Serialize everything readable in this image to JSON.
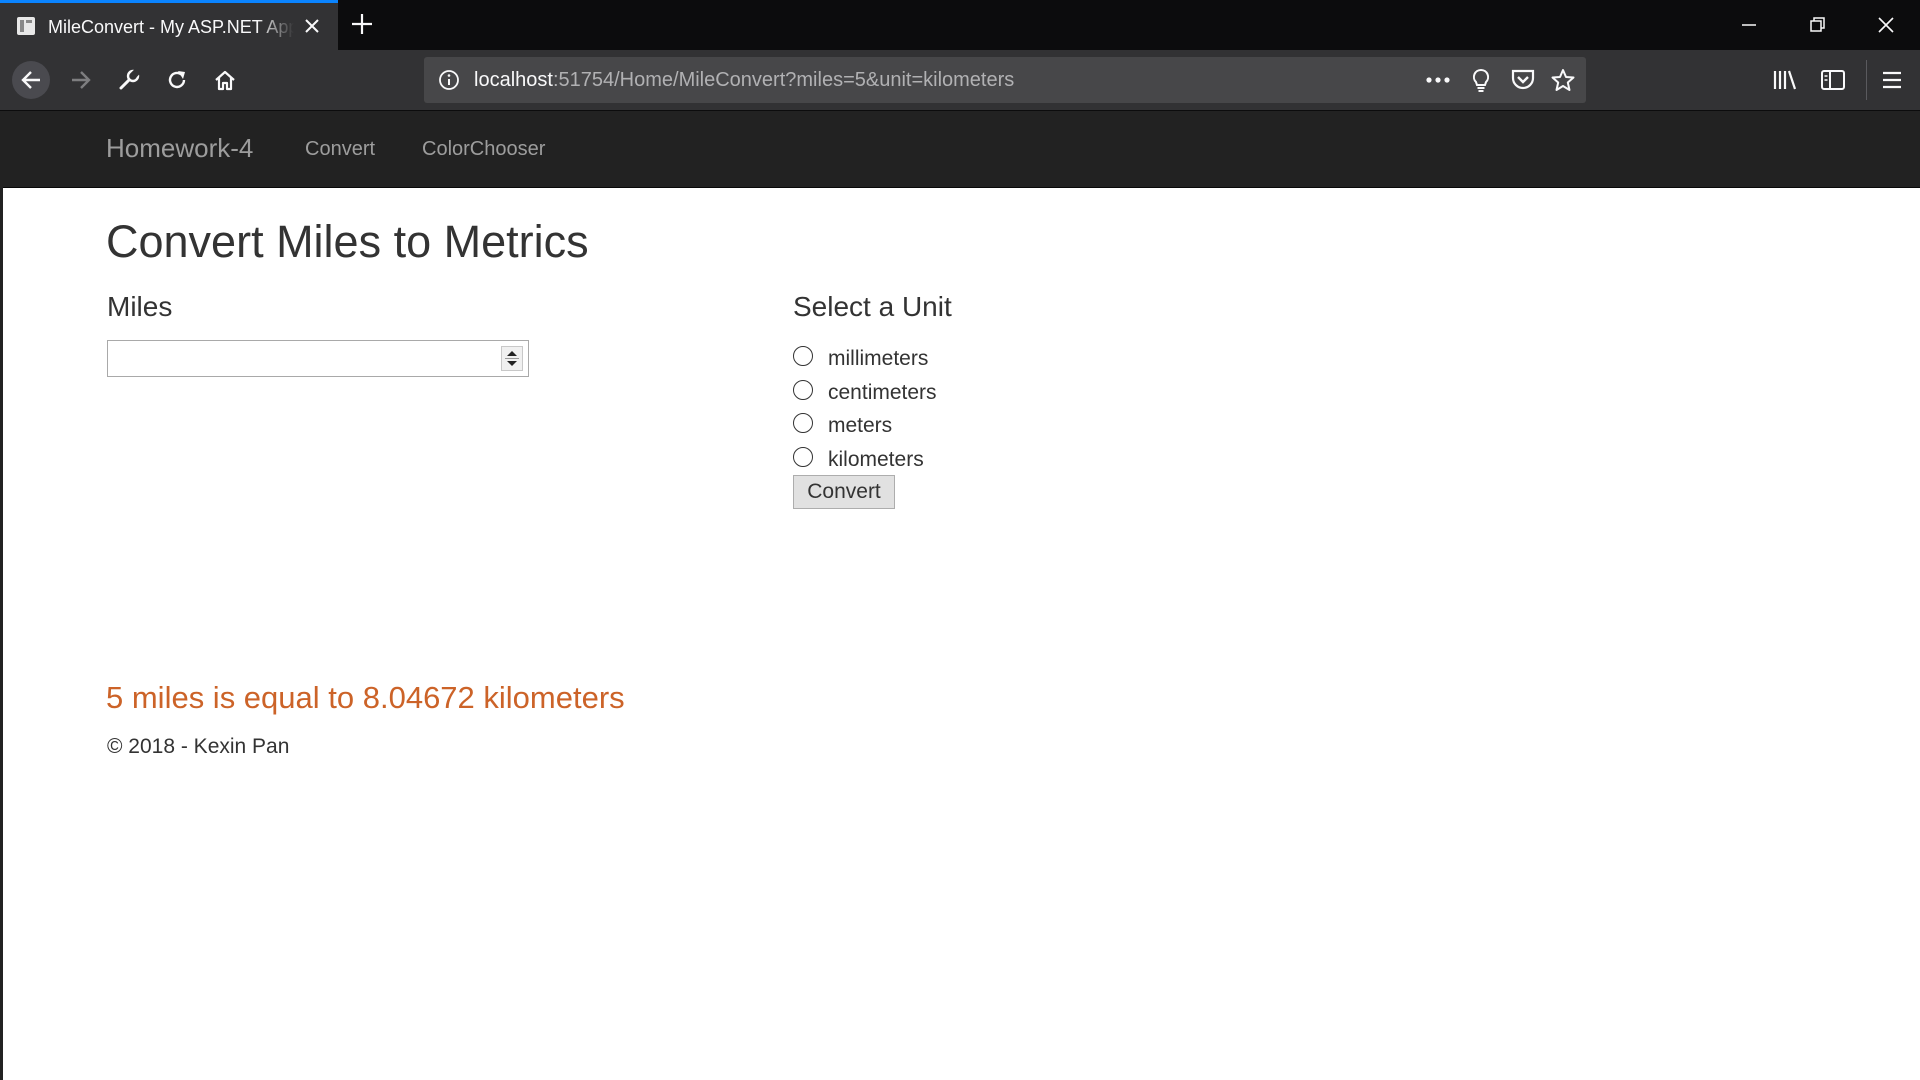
{
  "browser": {
    "tab_title": "MileConvert - My ASP.NET Application",
    "url_host": "localhost",
    "url_rest": ":51754/Home/MileConvert?miles=5&unit=kilometers"
  },
  "navbar": {
    "brand": "Homework-4",
    "links": [
      "Convert",
      "ColorChooser"
    ]
  },
  "page": {
    "title": "Convert Miles to Metrics",
    "miles_label": "Miles",
    "miles_value": "",
    "unit_label": "Select a Unit",
    "units": [
      "millimeters",
      "centimeters",
      "meters",
      "kilometers"
    ],
    "convert_button": "Convert",
    "result": "5 miles is equal to 8.04672 kilometers",
    "footer": "© 2018 - Kexin Pan"
  },
  "colors": {
    "result": "#cc6328",
    "navbar_bg": "#222222"
  }
}
